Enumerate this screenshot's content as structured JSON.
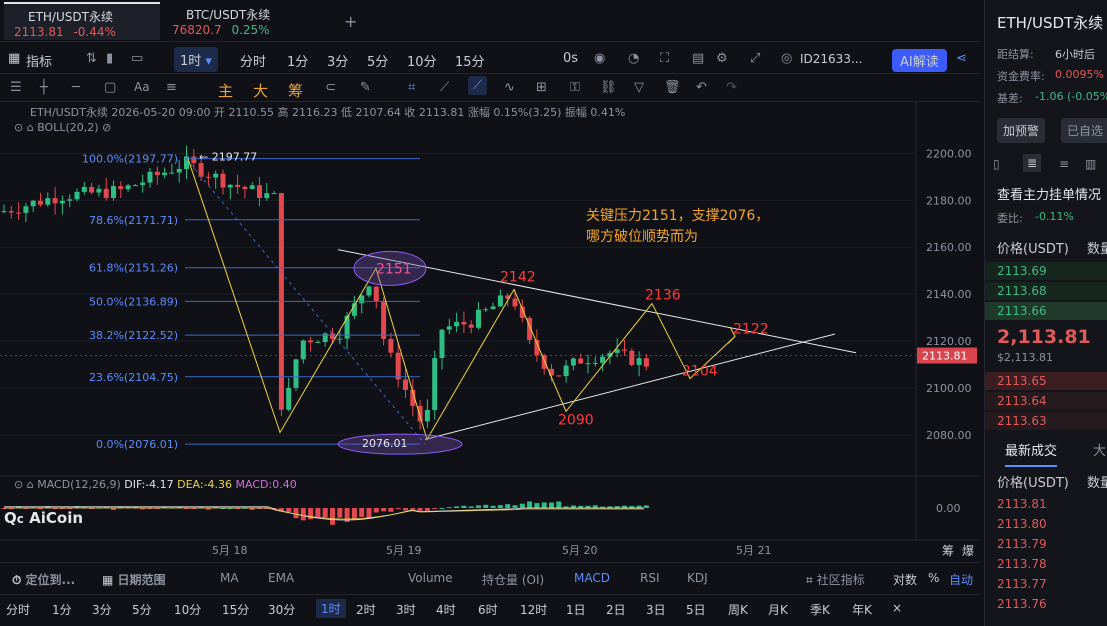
{
  "tabs": [
    {
      "name": "ETH/USDT永续",
      "price": "2113.81",
      "change": "-0.44%"
    },
    {
      "name": "BTC/USDT永续",
      "price": "76820.7",
      "change": "0.25%"
    }
  ],
  "new_tab": "+",
  "toolbar": {
    "indicator": "指标",
    "interval": "1时",
    "items": [
      "分时",
      "1分",
      "3分",
      "5分",
      "10分",
      "15分"
    ],
    "zero": "0s",
    "account": "ID21633...",
    "ai": "AI解读"
  },
  "drawbar": {
    "zhu": "主",
    "da": "大",
    "chou": "筹"
  },
  "info": {
    "line": "ETH/USDT永续  2026-05-20 09:00  开 2110.55  高 2116.23  低 2107.64  收 2113.81  涨幅 0.15%(3.25)  振幅 0.41%",
    "boll": "BOLL(20,2)"
  },
  "fib": [
    {
      "label": "100.0%(2197.77)",
      "value": 2197.77
    },
    {
      "label": "78.6%(2171.71)",
      "value": 2171.71
    },
    {
      "label": "61.8%(2151.26)",
      "value": 2151.26
    },
    {
      "label": "50.0%(2136.89)",
      "value": 2136.89
    },
    {
      "label": "38.2%(2122.52)",
      "value": 2122.52
    },
    {
      "label": "23.6%(2104.75)",
      "value": 2104.75
    },
    {
      "label": "0.0%(2076.01)",
      "value": 2076.01
    }
  ],
  "annotations": {
    "high": "2197.77",
    "low": "2076.01",
    "note1": "关键压力2151，支撑2076，",
    "note2": "哪方破位顺势而为",
    "p2151": "2151",
    "p2142": "2142",
    "p2136": "2136",
    "p2122": "2122",
    "p2104": "2104",
    "p2090": "2090"
  },
  "chart_data": {
    "type": "line",
    "title": "ETH/USDT永续",
    "ylim": [
      2065,
      2210
    ],
    "y_ticks": [
      "2200.00",
      "2180.00",
      "2160.00",
      "2140.00",
      "2120.00",
      "2100.00",
      "2080.00"
    ],
    "x_ticks": [
      "5月 18",
      "5月 19",
      "5月 20",
      "5月 21"
    ],
    "current_price": "2113.81",
    "series": [
      {
        "name": "path",
        "values": [
          2197.77,
          2081,
          2151,
          2078,
          2142,
          2090,
          2136,
          2104,
          2122
        ]
      }
    ]
  },
  "macd": {
    "label": "MACD(12,26,9)",
    "dif": "DIF:-4.17",
    "dea": "DEA:-4.36",
    "macd": "MACD:0.40",
    "zero": "0.00"
  },
  "corner": {
    "a": "筹",
    "b": "爆"
  },
  "logo": "AiCoin",
  "bottom1": {
    "items": [
      "定位到...",
      "日期范围",
      "MA",
      "EMA",
      "Volume",
      "持仓量 (OI)",
      "MACD",
      "RSI",
      "KDJ",
      "社区指标",
      "对数",
      "%",
      "自动"
    ]
  },
  "bottom2": {
    "items": [
      "分时",
      "1分",
      "3分",
      "5分",
      "10分",
      "15分",
      "30分",
      "1时",
      "2时",
      "3时",
      "4时",
      "6时",
      "12时",
      "1日",
      "2日",
      "3日",
      "5日",
      "周K",
      "月K",
      "季K",
      "年K",
      "×"
    ]
  },
  "right": {
    "title": "ETH/USDT永续",
    "settle_label": "距结算:",
    "settle_val": "6小时后",
    "fee_label": "资金费率:",
    "fee_val": "0.0095%",
    "basis_label": "基差:",
    "basis_val": "-1.06 (-0.05%)",
    "add_alert": "加预警",
    "added": "已自选",
    "book_title": "查看主力挂单情况",
    "ratio_label": "委比:",
    "ratio_val": "-0.11%",
    "price_hdr": "价格(USDT)",
    "qty_hdr": "数量",
    "bids": [
      "2113.69",
      "2113.68",
      "2113.66"
    ],
    "mid": "2,113.81",
    "mid_sub": "$2,113.81",
    "asks": [
      "2113.65",
      "2113.64",
      "2113.63"
    ],
    "trades_tab": "最新成交",
    "trades_tab2": "大",
    "trade_hdr": "价格(USDT)",
    "trade_qty": "数量",
    "trades": [
      "2113.81",
      "2113.80",
      "2113.79",
      "2113.78",
      "2113.77",
      "2113.76"
    ]
  }
}
